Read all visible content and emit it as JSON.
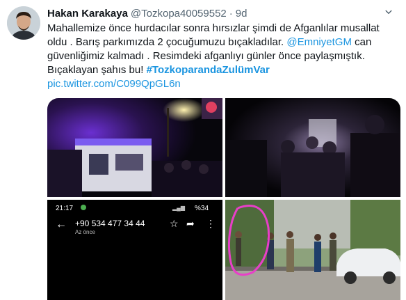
{
  "author": {
    "display_name": "Hakan Karakaya",
    "handle": "@Tozkopa40059552",
    "separator": "·",
    "time": "9d"
  },
  "tweet": {
    "line1": "Mahallemize önce hurdacılar sonra hırsızlar şimdi de Afganlılar musallat",
    "line2": "oldu . Barış parkımızda 2 çocuğumuzu bıçakladılar.",
    "mention": "@EmniyetGM",
    "line2_end": " can",
    "line3": "güvenliğimiz kalmadı . Resimdeki afganlıyı günler önce paylaşmıştık.",
    "line4": "Bıçaklayan şahıs bu!",
    "hashtag": "#TozkoparandaZulümVar",
    "link": "pic.twitter.com/C099QpGL6n"
  },
  "phone_screenshot": {
    "clock": "21:17",
    "status": "%34",
    "number": "+90 534 477 34 44",
    "subtitle": "Az önce"
  },
  "colors": {
    "link": "#1b95e0",
    "text": "#0f1419",
    "secondary": "#536471"
  }
}
